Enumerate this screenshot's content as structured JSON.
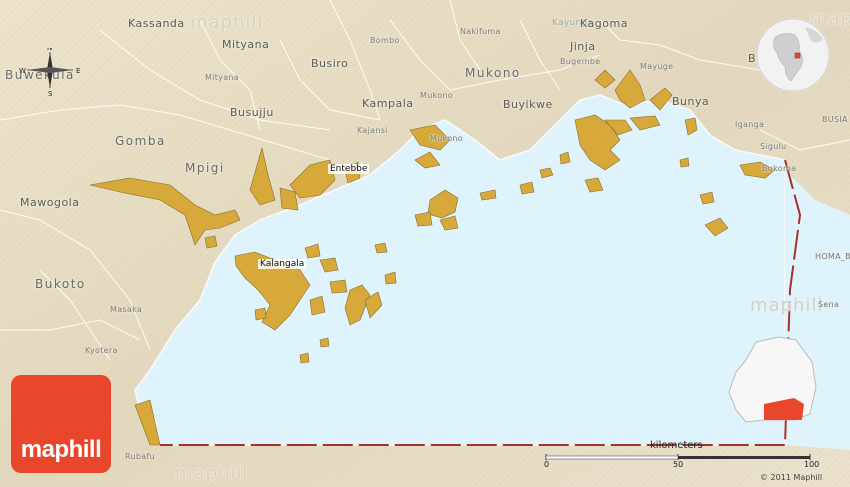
{
  "colors": {
    "land": "#e6ddc5",
    "lake": "#dff3fd",
    "island": "#d7a93a",
    "border": "#a5322a",
    "logo": "#e8472b",
    "roads": "#ffffff"
  },
  "places": {
    "kassanda": "Kassanda",
    "kayunga_faded": "Kayunga",
    "kagoma": "Kagoma",
    "buwekula": "Buwekula",
    "mityana_1": "Mityana",
    "mityana_2": "Mityana",
    "busiro": "Busiro",
    "bombo": "Bombo",
    "nakifuma": "Nakifuma",
    "jinja": "Jinja",
    "bugembe": "Bugembe",
    "mayuge": "Mayuge",
    "bukoto_ne": "Buko",
    "mukono_1": "Mukono",
    "mukono_2": "Mukono",
    "mukono_3": "Mukono",
    "kampala": "Kampala",
    "busujju": "Busujju",
    "buyikwe": "Buyikwe",
    "bunya": "Bunya",
    "busia": "BUSIA",
    "kajansi": "Kajansi",
    "iganga": "Iganga",
    "gomba": "Gomba",
    "entebbe": "Entebbe",
    "sigulu": "Sigulu",
    "bukoma": "Bukoma",
    "mpigi": "Mpigi",
    "mawogola": "Mawogola",
    "homa_bay": "HOMA_BA",
    "kalangala": "Kalangala",
    "bukoto": "Bukoto",
    "sena": "Sena",
    "masaka": "Masaka",
    "kyotera": "Kyotera",
    "rubafu": "Rubafu"
  },
  "compass": {
    "n": "N",
    "s": "S",
    "e": "E",
    "w": "W"
  },
  "logo": {
    "text": "maphill"
  },
  "scale": {
    "title": "kilometers",
    "ticks": [
      "0",
      "50",
      "100"
    ],
    "max_km": 100
  },
  "watermarks": {
    "w1": "maphill",
    "w2": "maphill",
    "w3": "maphill",
    "w4": "maphill"
  },
  "copyright": "© 2011 Maphill",
  "icons": {
    "compass": "compass-rose-icon",
    "globe": "globe-locator-icon",
    "inset": "uganda-inset-icon"
  }
}
